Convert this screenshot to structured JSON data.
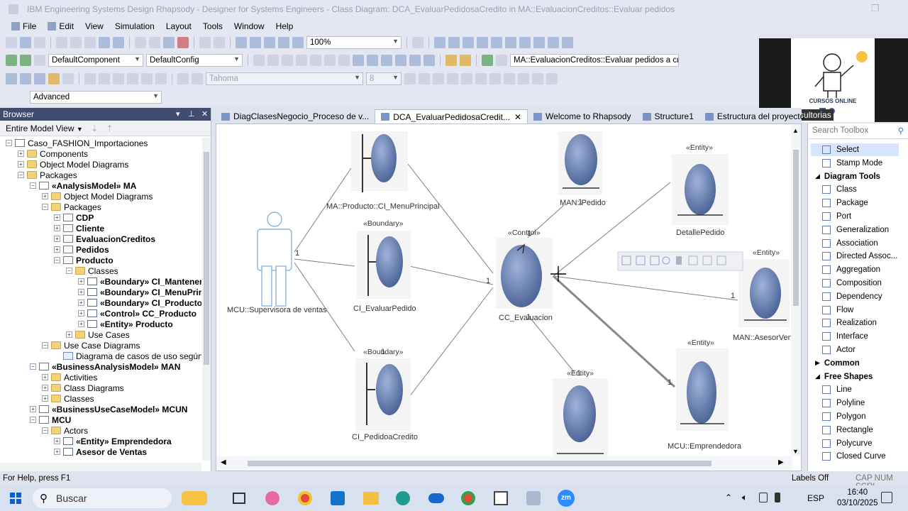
{
  "window": {
    "title": "IBM Engineering Systems Design Rhapsody - Designer for Systems Engineers - Class Diagram: DCA_EvaluarPedidosaCredito in MA::EvaluacionCreditos::Evaluar pedidos"
  },
  "menu": [
    "File",
    "Edit",
    "View",
    "Simulation",
    "Layout",
    "Tools",
    "Window",
    "Help"
  ],
  "toolbar": {
    "zoom": "100%",
    "component": "DefaultComponent",
    "config": "DefaultConfig",
    "locator": "MA::EvaluacionCreditos::Evaluar pedidos a credit",
    "font": "Tahoma",
    "font_size": "8",
    "mode": "Advanced"
  },
  "browser": {
    "title": "Browser",
    "view": "Entire Model View",
    "tree": [
      {
        "label": "Caso_FASHION_Importaciones",
        "level": 0,
        "exp": "-",
        "icon": "pkg",
        "bold": false
      },
      {
        "label": "Components",
        "level": 1,
        "exp": "+",
        "icon": "folder",
        "bold": false
      },
      {
        "label": "Object Model Diagrams",
        "level": 1,
        "exp": "+",
        "icon": "folder",
        "bold": false
      },
      {
        "label": "Packages",
        "level": 1,
        "exp": "-",
        "icon": "folder",
        "bold": false
      },
      {
        "label": "«AnalysisModel» MA",
        "level": 2,
        "exp": "-",
        "icon": "pkg",
        "bold": true
      },
      {
        "label": "Object Model Diagrams",
        "level": 3,
        "exp": "+",
        "icon": "folder",
        "bold": false
      },
      {
        "label": "Packages",
        "level": 3,
        "exp": "-",
        "icon": "folder",
        "bold": false
      },
      {
        "label": "CDP",
        "level": 4,
        "exp": "+",
        "icon": "pkg",
        "bold": true
      },
      {
        "label": "Cliente",
        "level": 4,
        "exp": "+",
        "icon": "pkg",
        "bold": true
      },
      {
        "label": "EvaluacionCreditos",
        "level": 4,
        "exp": "+",
        "icon": "pkg",
        "bold": true
      },
      {
        "label": "Pedidos",
        "level": 4,
        "exp": "+",
        "icon": "pkg",
        "bold": true
      },
      {
        "label": "Producto",
        "level": 4,
        "exp": "-",
        "icon": "pkg",
        "bold": true
      },
      {
        "label": "Classes",
        "level": 5,
        "exp": "-",
        "icon": "folder",
        "bold": false
      },
      {
        "label": "«Boundary» CI_MantenerF",
        "level": 6,
        "exp": "+",
        "icon": "cls",
        "bold": true
      },
      {
        "label": "«Boundary» CI_MenuPrinc",
        "level": 6,
        "exp": "+",
        "icon": "cls",
        "bold": true
      },
      {
        "label": "«Boundary» CI_Producto",
        "level": 6,
        "exp": "+",
        "icon": "cls",
        "bold": true
      },
      {
        "label": "«Control» CC_Producto",
        "level": 6,
        "exp": "+",
        "icon": "cls",
        "bold": true
      },
      {
        "label": "«Entity» Producto",
        "level": 6,
        "exp": "+",
        "icon": "cls",
        "bold": true
      },
      {
        "label": "Use Cases",
        "level": 5,
        "exp": "+",
        "icon": "folder",
        "bold": false
      },
      {
        "label": "Use Case Diagrams",
        "level": 3,
        "exp": "-",
        "icon": "folder",
        "bold": false
      },
      {
        "label": "Diagrama de casos de uso según ar",
        "level": 4,
        "exp": "",
        "icon": "diag",
        "bold": false
      },
      {
        "label": "«BusinessAnalysisModel» MAN",
        "level": 2,
        "exp": "-",
        "icon": "pkg",
        "bold": true
      },
      {
        "label": "Activities",
        "level": 3,
        "exp": "+",
        "icon": "folder",
        "bold": false
      },
      {
        "label": "Class Diagrams",
        "level": 3,
        "exp": "+",
        "icon": "folder",
        "bold": false
      },
      {
        "label": "Classes",
        "level": 3,
        "exp": "+",
        "icon": "folder",
        "bold": false
      },
      {
        "label": "«BusinessUseCaseModel» MCUN",
        "level": 2,
        "exp": "+",
        "icon": "pkg",
        "bold": true
      },
      {
        "label": "MCU",
        "level": 2,
        "exp": "-",
        "icon": "pkg",
        "bold": true
      },
      {
        "label": "Actors",
        "level": 3,
        "exp": "-",
        "icon": "folder",
        "bold": false
      },
      {
        "label": "«Entity» Emprendedora",
        "level": 4,
        "exp": "+",
        "icon": "cls",
        "bold": true
      },
      {
        "label": "Asesor de Ventas",
        "level": 4,
        "exp": "+",
        "icon": "cls",
        "bold": true
      }
    ]
  },
  "tabs": [
    {
      "label": "DiagClasesNegocio_Proceso de v...",
      "active": false
    },
    {
      "label": "DCA_EvaluarPedidosaCredit...",
      "active": true
    },
    {
      "label": "Welcome to Rhapsody",
      "active": false
    },
    {
      "label": "Structure1",
      "active": false
    },
    {
      "label": "Estructura del proyecto",
      "active": false
    }
  ],
  "diagram": {
    "actor": "MCU::Supervisora de ventas",
    "boundary1": "MA::Producto::CI_MenuPrincipal",
    "boundary2_stereo": "«Boundary»",
    "boundary2": "CI_EvaluarPedido",
    "boundary3_stereo": "«Boundary»",
    "boundary3": "CI_PedidoaCredito",
    "control_stereo": "«Control»",
    "control": "CC_Evaluacion",
    "entity_pedido": "MAN::Pedido",
    "detalle_stereo": "«Entity»",
    "detalle": "DetallePedido",
    "asesor_stereo": "«Entity»",
    "asesor": "MAN::AsesorVen",
    "empr_stereo": "«Entity»",
    "empr": "MCU::Emprendedora",
    "bottom_stereo": "«Entity»",
    "mult_one": "1"
  },
  "toolbox": {
    "search_placeholder": "Search Toolbox",
    "items": [
      {
        "label": "Select",
        "type": "item",
        "selected": true
      },
      {
        "label": "Stamp Mode",
        "type": "item"
      },
      {
        "label": "Diagram Tools",
        "type": "group",
        "arrow": "◢"
      },
      {
        "label": "Class",
        "type": "item"
      },
      {
        "label": "Package",
        "type": "item"
      },
      {
        "label": "Port",
        "type": "item"
      },
      {
        "label": "Generalization",
        "type": "item"
      },
      {
        "label": "Association",
        "type": "item"
      },
      {
        "label": "Directed Assoc...",
        "type": "item"
      },
      {
        "label": "Aggregation",
        "type": "item"
      },
      {
        "label": "Composition",
        "type": "item"
      },
      {
        "label": "Dependency",
        "type": "item"
      },
      {
        "label": "Flow",
        "type": "item"
      },
      {
        "label": "Realization",
        "type": "item"
      },
      {
        "label": "Interface",
        "type": "item"
      },
      {
        "label": "Actor",
        "type": "item"
      },
      {
        "label": "Common",
        "type": "group",
        "arrow": "▶"
      },
      {
        "label": "Free Shapes",
        "type": "group",
        "arrow": "◢"
      },
      {
        "label": "Line",
        "type": "item"
      },
      {
        "label": "Polyline",
        "type": "item"
      },
      {
        "label": "Polygon",
        "type": "item"
      },
      {
        "label": "Rectangle",
        "type": "item"
      },
      {
        "label": "Polycurve",
        "type": "item"
      },
      {
        "label": "Closed Curve",
        "type": "item"
      }
    ]
  },
  "status": {
    "help": "For Help, press F1",
    "labels": "Labels Off",
    "keys": "CAP NUM SCRL"
  },
  "promo": {
    "card_text": "CURSOS ONLINE",
    "caption": "EMR Consultorias"
  },
  "taskbar": {
    "search": "Buscar",
    "lang": "ESP",
    "time": "16:40",
    "date": "03/10/2025"
  }
}
